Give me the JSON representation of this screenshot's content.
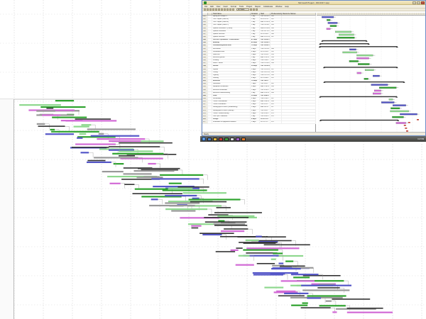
{
  "window": {
    "title": "Microsoft Project - DR-0317.mpp",
    "menu": [
      "File",
      "Edit",
      "View",
      "Insert",
      "Format",
      "Tools",
      "Project",
      "Report",
      "Collaborate",
      "Window",
      "Help"
    ],
    "toolbar_select": "All Tasks",
    "status": "Ready"
  },
  "sheet": {
    "columns": [
      "",
      "",
      "Task Name",
      "Duration",
      "Start",
      "Predecessors",
      "Resource Names"
    ],
    "rows": [
      {
        "id": "181",
        "name": "Spring test Subject 1",
        "dur": "1 day",
        "start": "Thu 11/10/11",
        "pred": "180",
        "res": "",
        "summary": false
      },
      {
        "id": "182",
        "name": "Test Chapter (Gantt B)",
        "dur": "1 day",
        "start": "Fri 11/11/11",
        "pred": "181",
        "res": "",
        "summary": false
      },
      {
        "id": "183",
        "name": "Test Chapter (Gantt B)",
        "dur": "1 day",
        "start": "Mon 11/14/11",
        "pred": "182",
        "res": "",
        "summary": false
      },
      {
        "id": "184",
        "name": "Test Chapter (Gantt C)",
        "dur": "1 day",
        "start": "Tue 11/15/11",
        "pred": "183",
        "res": "",
        "summary": false
      },
      {
        "id": "185",
        "name": "Update installation 3 (Gantt)",
        "dur": "1 day",
        "start": "Wed 11/16/11",
        "pred": "184",
        "res": "",
        "summary": false
      },
      {
        "id": "186",
        "name": "Update installation",
        "dur": "1 day",
        "start": "Thu 11/17/11",
        "pred": "185",
        "res": "",
        "summary": false
      },
      {
        "id": "187",
        "name": "Update Structure",
        "dur": "1 day",
        "start": "Fri 11/18/11",
        "pred": "186",
        "res": "",
        "summary": false
      },
      {
        "id": "188",
        "name": "Update Structure",
        "dur": "1 day",
        "start": "Mon 11/21/11",
        "pred": "187",
        "res": "",
        "summary": false
      },
      {
        "id": "189",
        "name": "Full Rev. Operations / Construction",
        "dur": "47 days",
        "start": "Tue 11/22/11",
        "pred": "",
        "res": "",
        "summary": true
      },
      {
        "id": "190",
        "name": "Building",
        "dur": "42 days",
        "start": "Tue 11/22/11",
        "pred": "",
        "res": "",
        "summary": true
      },
      {
        "id": "191",
        "name": "Foundation/ground work",
        "dur": "12 days",
        "start": "Tue 11/22/11",
        "pred": "",
        "res": "",
        "summary": true
      },
      {
        "id": "192",
        "name": "Excavation",
        "dur": "3 days",
        "start": "Tue 11/22/11",
        "pred": "188",
        "res": "",
        "summary": false
      },
      {
        "id": "193",
        "name": "Foundation work",
        "dur": "4 days",
        "start": "Fri 11/25/11",
        "pred": "192",
        "res": "",
        "summary": false
      },
      {
        "id": "194",
        "name": "Slab/Pour",
        "dur": "2 days",
        "start": "Thu 12/1/11",
        "pred": "193",
        "res": "",
        "summary": false
      },
      {
        "id": "195",
        "name": "Electrical ground",
        "dur": "1 day",
        "start": "Mon 12/5/11",
        "pred": "194",
        "res": "",
        "summary": false
      },
      {
        "id": "196",
        "name": "Framing",
        "dur": "5 days",
        "start": "Tue 12/6/11",
        "pred": "195",
        "res": "",
        "summary": false
      },
      {
        "id": "197",
        "name": "Water / Sewer",
        "dur": "2 days",
        "start": "Tue 12/13/11",
        "pred": "196",
        "res": "",
        "summary": false
      },
      {
        "id": "198",
        "name": "Interior",
        "dur": "20 days",
        "start": "Thu 12/15/11",
        "pred": "",
        "res": "",
        "summary": true
      },
      {
        "id": "199",
        "name": "Drywall",
        "dur": "5 days",
        "start": "Thu 12/15/11",
        "pred": "197",
        "res": "",
        "summary": false
      },
      {
        "id": "200",
        "name": "Ceiling",
        "dur": "3 days",
        "start": "Thu 12/22/11",
        "pred": "199",
        "res": "",
        "summary": false
      },
      {
        "id": "201",
        "name": "Lighting",
        "dur": "3 days",
        "start": "Tue 12/27/11",
        "pred": "200",
        "res": "",
        "summary": false
      },
      {
        "id": "202",
        "name": "Flooring",
        "dur": "4 days",
        "start": "Fri 12/30/11",
        "pred": "201",
        "res": "",
        "summary": false
      },
      {
        "id": "203",
        "name": "Electrical",
        "dur": "12 days",
        "start": "Thu 1/5/12",
        "pred": "",
        "res": "",
        "summary": true
      },
      {
        "id": "204",
        "name": "Substation",
        "dur": "7 days",
        "start": "Thu 1/5/12",
        "pred": "202",
        "res": "",
        "summary": false
      },
      {
        "id": "205",
        "name": "Equipment installation",
        "dur": "3 days",
        "start": "Mon 1/16/12",
        "pred": "204",
        "res": "",
        "summary": false
      },
      {
        "id": "206",
        "name": "Electrical installation",
        "dur": "2 days",
        "start": "Thu 1/19/12",
        "pred": "205",
        "res": "",
        "summary": false
      },
      {
        "id": "207",
        "name": "Electrical commissioning",
        "dur": "1 day",
        "start": "Mon 1/23/12",
        "pred": "206",
        "res": "",
        "summary": false
      },
      {
        "id": "208",
        "name": "Plant",
        "dur": "25 days",
        "start": "Tue 1/24/12",
        "pred": "",
        "res": "",
        "summary": true
      },
      {
        "id": "209",
        "name": "Scheduling",
        "dur": "4 days",
        "start": "Tue 1/24/12",
        "pred": "207",
        "res": "",
        "summary": false
      },
      {
        "id": "210",
        "name": "Trench Groundwater",
        "dur": "3 days",
        "start": "Mon 1/30/12",
        "pred": "209",
        "res": "",
        "summary": false
      },
      {
        "id": "211",
        "name": "Trench Foundation",
        "dur": "2 days",
        "start": "Thu 2/2/12",
        "pred": "210",
        "res": "",
        "summary": false
      },
      {
        "id": "212",
        "name": "Setting pipe in trench (conditioning)",
        "dur": "3 days",
        "start": "Mon 2/6/12",
        "pred": "211",
        "res": "",
        "summary": false
      },
      {
        "id": "213",
        "name": "Setting pipe in trench (startup)",
        "dur": "3 days",
        "start": "Thu 2/9/12",
        "pred": "212",
        "res": "",
        "summary": false
      },
      {
        "id": "214",
        "name": "Trench Commissioning",
        "dur": "2 days",
        "start": "Tue 2/14/12",
        "pred": "213",
        "res": "",
        "summary": false
      },
      {
        "id": "215",
        "name": "Test Pipe Calibration",
        "dur": "1 day",
        "start": "Thu 2/16/12",
        "pred": "214",
        "res": "",
        "summary": false
      },
      {
        "id": "216",
        "name": "Design",
        "dur": "6 days",
        "start": "Fri 2/17/12",
        "pred": "",
        "res": "",
        "summary": true
      },
      {
        "id": "217",
        "name": "Installation of equipment modules",
        "dur": "2 days",
        "start": "Fri 2/17/12",
        "pred": "215",
        "res": "",
        "summary": false
      }
    ]
  },
  "taskbar": {
    "clock": "3:47 PM"
  },
  "colors": {
    "bar_blue": "#5557c8",
    "bar_green": "#2fa32f",
    "bar_magenta": "#d26ad6",
    "bar_summary": "#333333",
    "bar_light_green": "#8ed88e",
    "bar_red": "#c0392b"
  }
}
